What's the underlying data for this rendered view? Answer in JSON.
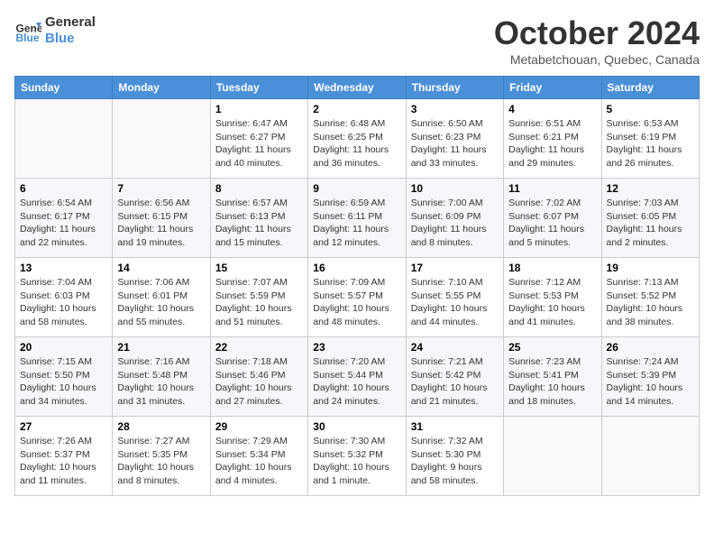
{
  "header": {
    "logo_line1": "General",
    "logo_line2": "Blue",
    "month_title": "October 2024",
    "subtitle": "Metabetchouan, Quebec, Canada"
  },
  "days_of_week": [
    "Sunday",
    "Monday",
    "Tuesday",
    "Wednesday",
    "Thursday",
    "Friday",
    "Saturday"
  ],
  "weeks": [
    [
      {
        "day": "",
        "info": ""
      },
      {
        "day": "",
        "info": ""
      },
      {
        "day": "1",
        "info": "Sunrise: 6:47 AM\nSunset: 6:27 PM\nDaylight: 11 hours and 40 minutes."
      },
      {
        "day": "2",
        "info": "Sunrise: 6:48 AM\nSunset: 6:25 PM\nDaylight: 11 hours and 36 minutes."
      },
      {
        "day": "3",
        "info": "Sunrise: 6:50 AM\nSunset: 6:23 PM\nDaylight: 11 hours and 33 minutes."
      },
      {
        "day": "4",
        "info": "Sunrise: 6:51 AM\nSunset: 6:21 PM\nDaylight: 11 hours and 29 minutes."
      },
      {
        "day": "5",
        "info": "Sunrise: 6:53 AM\nSunset: 6:19 PM\nDaylight: 11 hours and 26 minutes."
      }
    ],
    [
      {
        "day": "6",
        "info": "Sunrise: 6:54 AM\nSunset: 6:17 PM\nDaylight: 11 hours and 22 minutes."
      },
      {
        "day": "7",
        "info": "Sunrise: 6:56 AM\nSunset: 6:15 PM\nDaylight: 11 hours and 19 minutes."
      },
      {
        "day": "8",
        "info": "Sunrise: 6:57 AM\nSunset: 6:13 PM\nDaylight: 11 hours and 15 minutes."
      },
      {
        "day": "9",
        "info": "Sunrise: 6:59 AM\nSunset: 6:11 PM\nDaylight: 11 hours and 12 minutes."
      },
      {
        "day": "10",
        "info": "Sunrise: 7:00 AM\nSunset: 6:09 PM\nDaylight: 11 hours and 8 minutes."
      },
      {
        "day": "11",
        "info": "Sunrise: 7:02 AM\nSunset: 6:07 PM\nDaylight: 11 hours and 5 minutes."
      },
      {
        "day": "12",
        "info": "Sunrise: 7:03 AM\nSunset: 6:05 PM\nDaylight: 11 hours and 2 minutes."
      }
    ],
    [
      {
        "day": "13",
        "info": "Sunrise: 7:04 AM\nSunset: 6:03 PM\nDaylight: 10 hours and 58 minutes."
      },
      {
        "day": "14",
        "info": "Sunrise: 7:06 AM\nSunset: 6:01 PM\nDaylight: 10 hours and 55 minutes."
      },
      {
        "day": "15",
        "info": "Sunrise: 7:07 AM\nSunset: 5:59 PM\nDaylight: 10 hours and 51 minutes."
      },
      {
        "day": "16",
        "info": "Sunrise: 7:09 AM\nSunset: 5:57 PM\nDaylight: 10 hours and 48 minutes."
      },
      {
        "day": "17",
        "info": "Sunrise: 7:10 AM\nSunset: 5:55 PM\nDaylight: 10 hours and 44 minutes."
      },
      {
        "day": "18",
        "info": "Sunrise: 7:12 AM\nSunset: 5:53 PM\nDaylight: 10 hours and 41 minutes."
      },
      {
        "day": "19",
        "info": "Sunrise: 7:13 AM\nSunset: 5:52 PM\nDaylight: 10 hours and 38 minutes."
      }
    ],
    [
      {
        "day": "20",
        "info": "Sunrise: 7:15 AM\nSunset: 5:50 PM\nDaylight: 10 hours and 34 minutes."
      },
      {
        "day": "21",
        "info": "Sunrise: 7:16 AM\nSunset: 5:48 PM\nDaylight: 10 hours and 31 minutes."
      },
      {
        "day": "22",
        "info": "Sunrise: 7:18 AM\nSunset: 5:46 PM\nDaylight: 10 hours and 27 minutes."
      },
      {
        "day": "23",
        "info": "Sunrise: 7:20 AM\nSunset: 5:44 PM\nDaylight: 10 hours and 24 minutes."
      },
      {
        "day": "24",
        "info": "Sunrise: 7:21 AM\nSunset: 5:42 PM\nDaylight: 10 hours and 21 minutes."
      },
      {
        "day": "25",
        "info": "Sunrise: 7:23 AM\nSunset: 5:41 PM\nDaylight: 10 hours and 18 minutes."
      },
      {
        "day": "26",
        "info": "Sunrise: 7:24 AM\nSunset: 5:39 PM\nDaylight: 10 hours and 14 minutes."
      }
    ],
    [
      {
        "day": "27",
        "info": "Sunrise: 7:26 AM\nSunset: 5:37 PM\nDaylight: 10 hours and 11 minutes."
      },
      {
        "day": "28",
        "info": "Sunrise: 7:27 AM\nSunset: 5:35 PM\nDaylight: 10 hours and 8 minutes."
      },
      {
        "day": "29",
        "info": "Sunrise: 7:29 AM\nSunset: 5:34 PM\nDaylight: 10 hours and 4 minutes."
      },
      {
        "day": "30",
        "info": "Sunrise: 7:30 AM\nSunset: 5:32 PM\nDaylight: 10 hours and 1 minute."
      },
      {
        "day": "31",
        "info": "Sunrise: 7:32 AM\nSunset: 5:30 PM\nDaylight: 9 hours and 58 minutes."
      },
      {
        "day": "",
        "info": ""
      },
      {
        "day": "",
        "info": ""
      }
    ]
  ]
}
